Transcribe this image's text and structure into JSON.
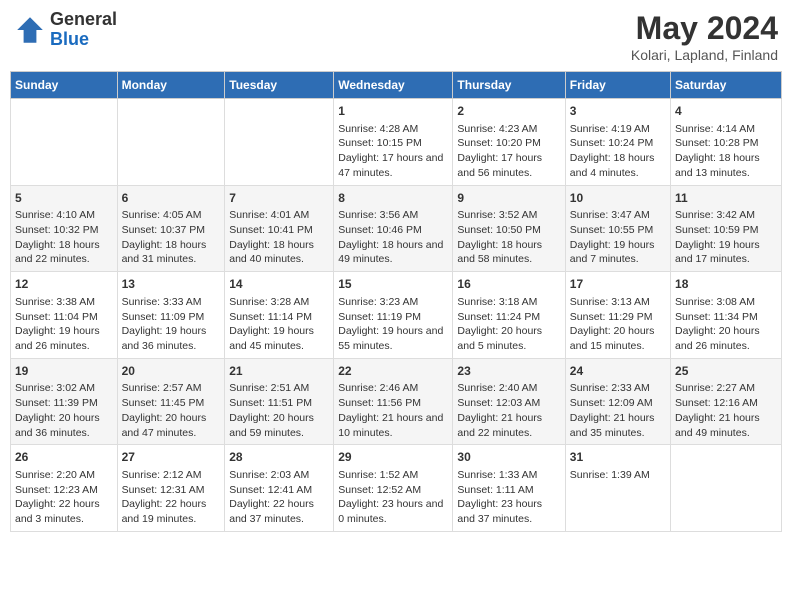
{
  "logo": {
    "general": "General",
    "blue": "Blue"
  },
  "title": "May 2024",
  "subtitle": "Kolari, Lapland, Finland",
  "weekdays": [
    "Sunday",
    "Monday",
    "Tuesday",
    "Wednesday",
    "Thursday",
    "Friday",
    "Saturday"
  ],
  "weeks": [
    [
      {
        "day": "",
        "sunrise": "",
        "sunset": "",
        "daylight": ""
      },
      {
        "day": "",
        "sunrise": "",
        "sunset": "",
        "daylight": ""
      },
      {
        "day": "",
        "sunrise": "",
        "sunset": "",
        "daylight": ""
      },
      {
        "day": "1",
        "sunrise": "Sunrise: 4:28 AM",
        "sunset": "Sunset: 10:15 PM",
        "daylight": "Daylight: 17 hours and 47 minutes."
      },
      {
        "day": "2",
        "sunrise": "Sunrise: 4:23 AM",
        "sunset": "Sunset: 10:20 PM",
        "daylight": "Daylight: 17 hours and 56 minutes."
      },
      {
        "day": "3",
        "sunrise": "Sunrise: 4:19 AM",
        "sunset": "Sunset: 10:24 PM",
        "daylight": "Daylight: 18 hours and 4 minutes."
      },
      {
        "day": "4",
        "sunrise": "Sunrise: 4:14 AM",
        "sunset": "Sunset: 10:28 PM",
        "daylight": "Daylight: 18 hours and 13 minutes."
      }
    ],
    [
      {
        "day": "5",
        "sunrise": "Sunrise: 4:10 AM",
        "sunset": "Sunset: 10:32 PM",
        "daylight": "Daylight: 18 hours and 22 minutes."
      },
      {
        "day": "6",
        "sunrise": "Sunrise: 4:05 AM",
        "sunset": "Sunset: 10:37 PM",
        "daylight": "Daylight: 18 hours and 31 minutes."
      },
      {
        "day": "7",
        "sunrise": "Sunrise: 4:01 AM",
        "sunset": "Sunset: 10:41 PM",
        "daylight": "Daylight: 18 hours and 40 minutes."
      },
      {
        "day": "8",
        "sunrise": "Sunrise: 3:56 AM",
        "sunset": "Sunset: 10:46 PM",
        "daylight": "Daylight: 18 hours and 49 minutes."
      },
      {
        "day": "9",
        "sunrise": "Sunrise: 3:52 AM",
        "sunset": "Sunset: 10:50 PM",
        "daylight": "Daylight: 18 hours and 58 minutes."
      },
      {
        "day": "10",
        "sunrise": "Sunrise: 3:47 AM",
        "sunset": "Sunset: 10:55 PM",
        "daylight": "Daylight: 19 hours and 7 minutes."
      },
      {
        "day": "11",
        "sunrise": "Sunrise: 3:42 AM",
        "sunset": "Sunset: 10:59 PM",
        "daylight": "Daylight: 19 hours and 17 minutes."
      }
    ],
    [
      {
        "day": "12",
        "sunrise": "Sunrise: 3:38 AM",
        "sunset": "Sunset: 11:04 PM",
        "daylight": "Daylight: 19 hours and 26 minutes."
      },
      {
        "day": "13",
        "sunrise": "Sunrise: 3:33 AM",
        "sunset": "Sunset: 11:09 PM",
        "daylight": "Daylight: 19 hours and 36 minutes."
      },
      {
        "day": "14",
        "sunrise": "Sunrise: 3:28 AM",
        "sunset": "Sunset: 11:14 PM",
        "daylight": "Daylight: 19 hours and 45 minutes."
      },
      {
        "day": "15",
        "sunrise": "Sunrise: 3:23 AM",
        "sunset": "Sunset: 11:19 PM",
        "daylight": "Daylight: 19 hours and 55 minutes."
      },
      {
        "day": "16",
        "sunrise": "Sunrise: 3:18 AM",
        "sunset": "Sunset: 11:24 PM",
        "daylight": "Daylight: 20 hours and 5 minutes."
      },
      {
        "day": "17",
        "sunrise": "Sunrise: 3:13 AM",
        "sunset": "Sunset: 11:29 PM",
        "daylight": "Daylight: 20 hours and 15 minutes."
      },
      {
        "day": "18",
        "sunrise": "Sunrise: 3:08 AM",
        "sunset": "Sunset: 11:34 PM",
        "daylight": "Daylight: 20 hours and 26 minutes."
      }
    ],
    [
      {
        "day": "19",
        "sunrise": "Sunrise: 3:02 AM",
        "sunset": "Sunset: 11:39 PM",
        "daylight": "Daylight: 20 hours and 36 minutes."
      },
      {
        "day": "20",
        "sunrise": "Sunrise: 2:57 AM",
        "sunset": "Sunset: 11:45 PM",
        "daylight": "Daylight: 20 hours and 47 minutes."
      },
      {
        "day": "21",
        "sunrise": "Sunrise: 2:51 AM",
        "sunset": "Sunset: 11:51 PM",
        "daylight": "Daylight: 20 hours and 59 minutes."
      },
      {
        "day": "22",
        "sunrise": "Sunrise: 2:46 AM",
        "sunset": "Sunset: 11:56 PM",
        "daylight": "Daylight: 21 hours and 10 minutes."
      },
      {
        "day": "23",
        "sunrise": "Sunrise: 2:40 AM",
        "sunset": "Sunset: 12:03 AM",
        "daylight": "Daylight: 21 hours and 22 minutes."
      },
      {
        "day": "24",
        "sunrise": "Sunrise: 2:33 AM",
        "sunset": "Sunset: 12:09 AM",
        "daylight": "Daylight: 21 hours and 35 minutes."
      },
      {
        "day": "25",
        "sunrise": "Sunrise: 2:27 AM",
        "sunset": "Sunset: 12:16 AM",
        "daylight": "Daylight: 21 hours and 49 minutes."
      }
    ],
    [
      {
        "day": "26",
        "sunrise": "Sunrise: 2:20 AM",
        "sunset": "Sunset: 12:23 AM",
        "daylight": "Daylight: 22 hours and 3 minutes."
      },
      {
        "day": "27",
        "sunrise": "Sunrise: 2:12 AM",
        "sunset": "Sunset: 12:31 AM",
        "daylight": "Daylight: 22 hours and 19 minutes."
      },
      {
        "day": "28",
        "sunrise": "Sunrise: 2:03 AM",
        "sunset": "Sunset: 12:41 AM",
        "daylight": "Daylight: 22 hours and 37 minutes."
      },
      {
        "day": "29",
        "sunrise": "Sunrise: 1:52 AM",
        "sunset": "Sunset: 12:52 AM",
        "daylight": "Daylight: 23 hours and 0 minutes."
      },
      {
        "day": "30",
        "sunrise": "Sunrise: 1:33 AM",
        "sunset": "Sunset: 1:11 AM",
        "daylight": "Daylight: 23 hours and 37 minutes."
      },
      {
        "day": "31",
        "sunrise": "Sunrise: 1:39 AM",
        "sunset": "",
        "daylight": ""
      },
      {
        "day": "",
        "sunrise": "",
        "sunset": "",
        "daylight": ""
      }
    ]
  ]
}
